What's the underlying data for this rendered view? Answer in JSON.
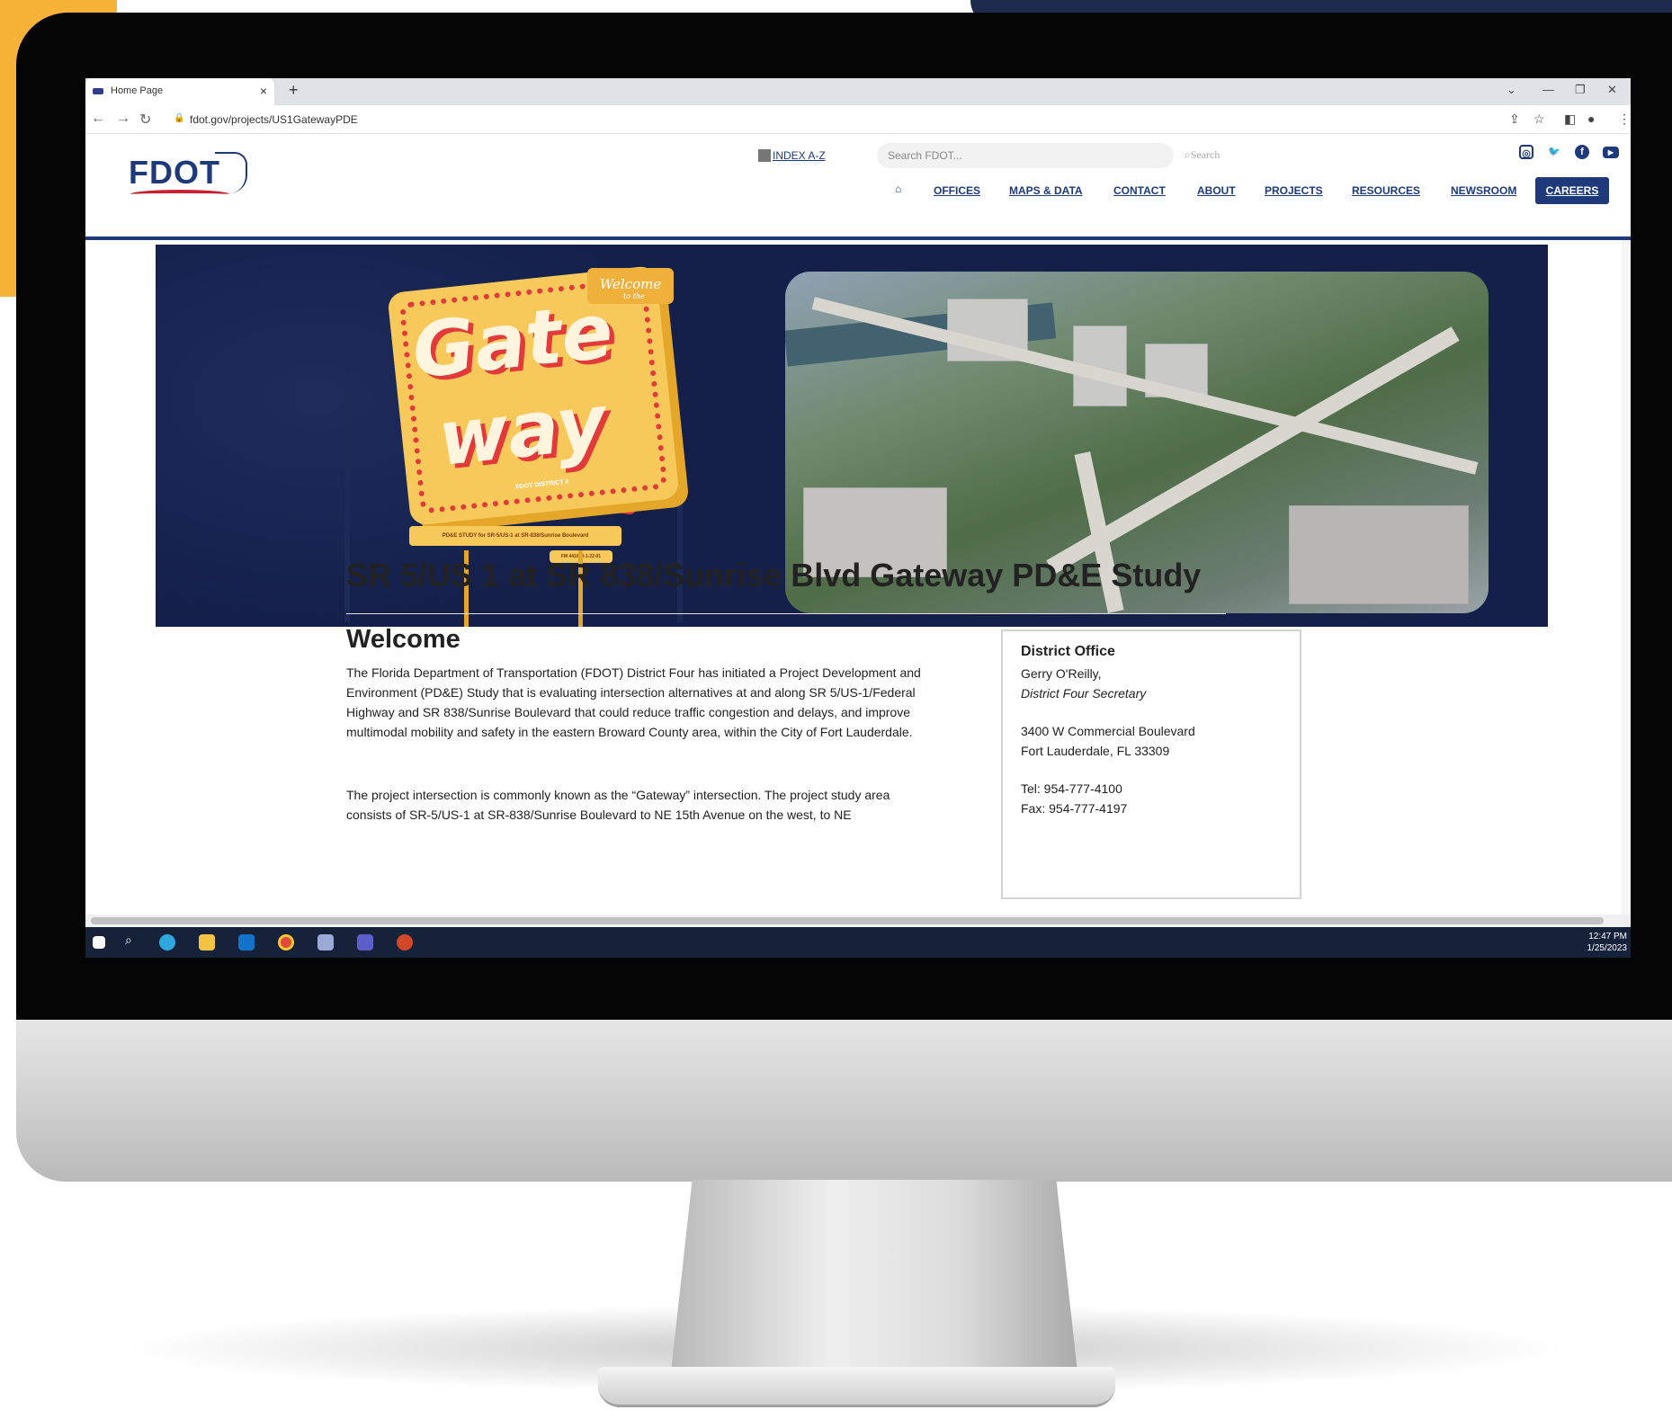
{
  "browser": {
    "tab_title": "Home Page",
    "tab_close": "×",
    "new_tab": "+",
    "url": "fdot.gov/projects/US1GatewayPDE"
  },
  "header": {
    "logo_text": "FDOT",
    "index_link": "INDEX A-Z",
    "search_placeholder": "Search FDOT...",
    "search_button": "Search",
    "nav": [
      "OFFICES",
      "MAPS & DATA",
      "CONTACT",
      "ABOUT",
      "PROJECTS",
      "RESOURCES",
      "NEWSROOM"
    ],
    "careers": "CAREERS"
  },
  "hero": {
    "welcome": "Welcome",
    "welcome_sub": "to the",
    "sign_word_1": "Gate",
    "sign_word_2": "way",
    "district": "FDOT DISTRICT 4",
    "board_text": "PD&E STUDY for SR-5/US-1 at SR-838/Sunrise Boulevard",
    "fm_text": "FM 441693-1-22-01"
  },
  "main": {
    "title": "SR 5/US 1 at SR 838/Sunrise Blvd Gateway PD&E Study",
    "heading": "Welcome",
    "paragraph_1": "The Florida Department of Transportation (FDOT) District Four has initiated a Project Development and Environment (PD&E) Study that is evaluating intersection alternatives at and along SR 5/US-1/Federal Highway and SR 838/Sunrise Boulevard that could reduce traffic congestion and delays, and improve multimodal mobility and safety in the eastern Broward County area, within the City of Fort Lauderdale.",
    "paragraph_2": "The project intersection is commonly known as the “Gateway” intersection. The project study area consists of SR-5/US-1 at SR-838/Sunrise Boulevard to NE 15th Avenue on the west, to NE"
  },
  "district_office": {
    "heading": "District Office",
    "name": "Gerry O'Reilly,",
    "role": "District Four Secretary",
    "address_1": "3400 W Commercial Boulevard",
    "address_2": "Fort Lauderdale, FL 33309",
    "tel": "Tel: 954-777-4100",
    "fax": "Fax: 954-777-4197"
  },
  "taskbar": {
    "time": "12:47 PM",
    "date": "1/25/2023"
  },
  "colors": {
    "fdot_navy": "#1e3a7b",
    "fdot_red": "#c8202f",
    "hero_bg": "#14204a",
    "accent_orange": "#f6b338"
  }
}
